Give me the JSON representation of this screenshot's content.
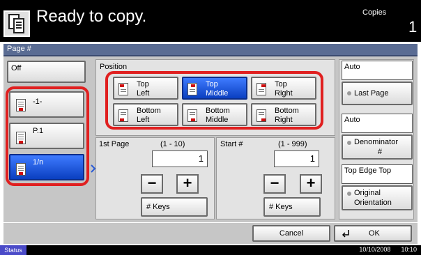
{
  "header": {
    "status_text": "Ready to copy.",
    "copies_label": "Copies",
    "copies_count": "1"
  },
  "page_title": "Page #",
  "left_options": {
    "off": "Off",
    "dash_one": "-1-",
    "p_one": "P.1",
    "one_n": "1/n"
  },
  "position": {
    "label": "Position",
    "top_left": [
      "Top",
      "Left"
    ],
    "top_middle": [
      "Top",
      "Middle"
    ],
    "top_right": [
      "Top",
      "Right"
    ],
    "bottom_left": [
      "Bottom",
      "Left"
    ],
    "bottom_middle": [
      "Bottom",
      "Middle"
    ],
    "bottom_right": [
      "Bottom",
      "Right"
    ]
  },
  "first_page": {
    "label": "1st Page",
    "range": "(1 - 10)",
    "value": "1",
    "keys": "# Keys"
  },
  "start_num": {
    "label": "Start #",
    "range": "(1 - 999)",
    "value": "1",
    "keys": "# Keys"
  },
  "right_panel": {
    "auto1": "Auto",
    "last_page": "Last Page",
    "auto2": "Auto",
    "denominator": [
      "Denominator",
      "#"
    ],
    "top_edge": "Top Edge Top",
    "original_orientation": [
      "Original",
      "Orientation"
    ]
  },
  "buttons": {
    "cancel": "Cancel",
    "ok": "OK"
  },
  "footer": {
    "status": "Status",
    "date": "10/10/2008",
    "time": "10:10"
  },
  "selected_position": "top_middle",
  "selected_left": "one_n"
}
